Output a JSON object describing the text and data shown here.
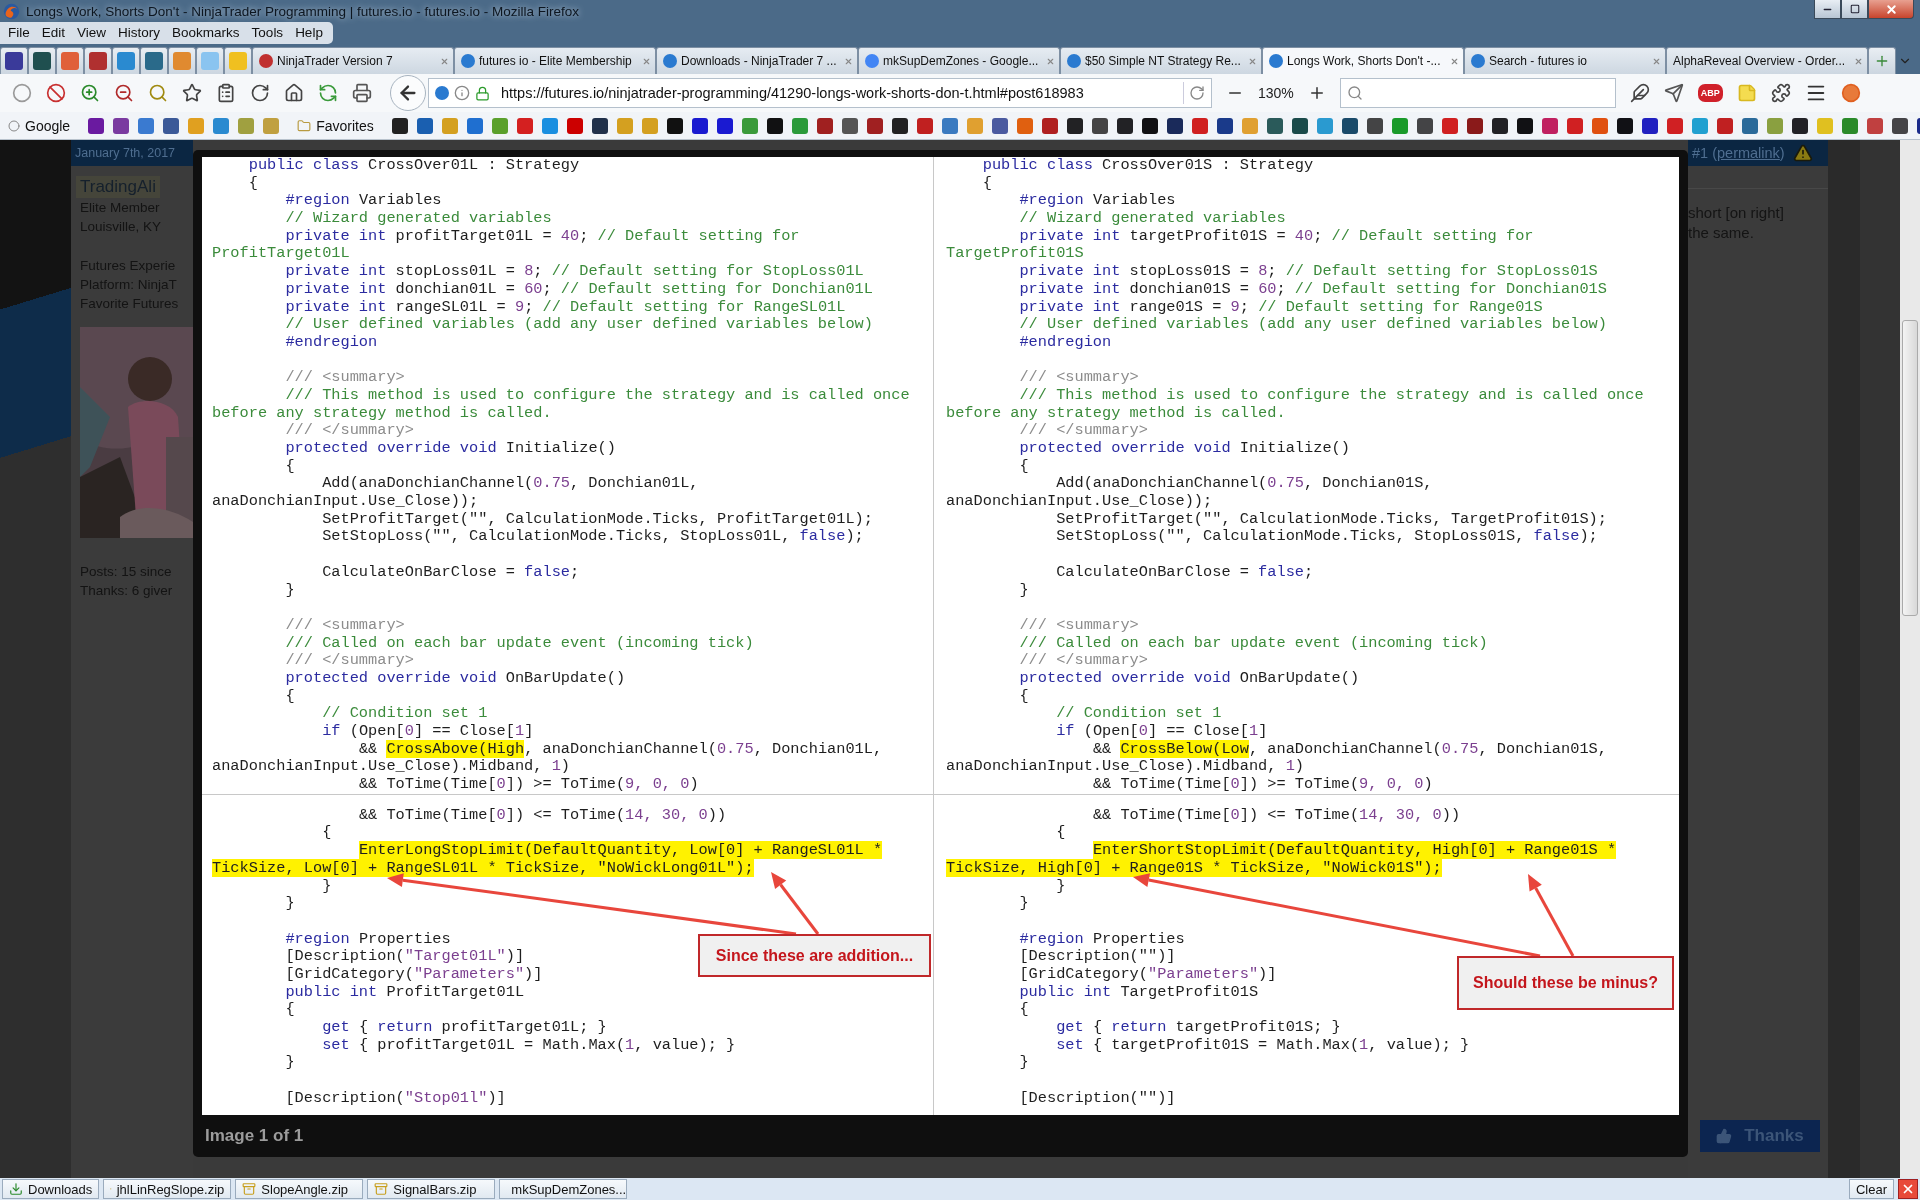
{
  "window": {
    "title": "Longs Work, Shorts Don't - NinjaTrader Programming | futures.io - futures.io - Mozilla Firefox"
  },
  "menu": [
    "File",
    "Edit",
    "View",
    "History",
    "Bookmarks",
    "Tools",
    "Help"
  ],
  "pinned_tabs": [
    {
      "color": "#3a3a9a",
      "selected": false
    },
    {
      "color": "#1f4f4f",
      "selected": false
    },
    {
      "color": "#e0603a",
      "selected": false
    },
    {
      "color": "#b03030",
      "selected": false
    },
    {
      "color": "#2a8ad0",
      "selected": false
    },
    {
      "color": "#2a6a8a",
      "selected": false
    },
    {
      "color": "#e08a30",
      "selected": false
    },
    {
      "color": "#8ac4f0",
      "selected": false
    },
    {
      "color": "#f0c020",
      "selected": false
    }
  ],
  "tabs": [
    {
      "label": "NinjaTrader Version 7",
      "color": "#c03030",
      "selected": false
    },
    {
      "label": "futures io - Elite Membership",
      "color": "#2a7ad0",
      "selected": false
    },
    {
      "label": "Downloads - NinjaTrader 7 ...",
      "color": "#2a7ad0",
      "selected": false
    },
    {
      "label": "mkSupDemZones - Google...",
      "color": "#4285f4",
      "selected": false
    },
    {
      "label": "$50 Simple NT Strategy Re...",
      "color": "#2a7ad0",
      "selected": false
    },
    {
      "label": "Longs Work, Shorts Don't -...",
      "color": "#2a7ad0",
      "selected": true
    },
    {
      "label": "Search - futures io",
      "color": "#2a7ad0",
      "selected": false
    },
    {
      "label": "AlphaReveal Overview - Order...",
      "selected": false
    }
  ],
  "address_bar": {
    "url": "https://futures.io/ninjatrader-programming/41290-longs-work-shorts-don-t.html#post618983"
  },
  "zoom_reading": "130%",
  "adblock_badge": "ABP",
  "bookmarks": {
    "google": "Google",
    "icons_before": [
      {
        "color": "#6a1aa0"
      },
      {
        "color": "#7a3aa0"
      },
      {
        "color": "#3a7ad0"
      },
      {
        "color": "#3b5998"
      },
      {
        "color": "#e0a020"
      },
      {
        "color": "#2a8ad0"
      },
      {
        "color": "#a0a040"
      },
      {
        "color": "#c0a040"
      }
    ],
    "favorites": "Favorites",
    "icons_after": [
      {
        "color": "#222222"
      },
      {
        "color": "#1a5fb0"
      },
      {
        "color": "#d4a020"
      },
      {
        "color": "#1f6fd0"
      },
      {
        "color": "#5aa02c"
      },
      {
        "color": "#d42020"
      },
      {
        "color": "#1a8fe0"
      },
      {
        "color": "#cc0000"
      },
      {
        "color": "#20304a"
      },
      {
        "color": "#d4a020"
      },
      {
        "color": "#d4a021"
      },
      {
        "color": "#111111"
      },
      {
        "color": "#1a1ad0"
      },
      {
        "color": "#1a1ad1"
      },
      {
        "color": "#3a9a3a"
      },
      {
        "color": "#111112"
      },
      {
        "color": "#2a9a3a"
      },
      {
        "color": "#a02020"
      },
      {
        "color": "#555555"
      },
      {
        "color": "#a02021"
      },
      {
        "color": "#222223"
      },
      {
        "color": "#c02020"
      },
      {
        "color": "#3a7ac0"
      },
      {
        "color": "#e0a030"
      },
      {
        "color": "#4a5aa0"
      },
      {
        "color": "#e06010"
      },
      {
        "color": "#b02020"
      },
      {
        "color": "#222224"
      },
      {
        "color": "#444444"
      },
      {
        "color": "#222225"
      },
      {
        "color": "#111113"
      },
      {
        "color": "#1a2a5a"
      },
      {
        "color": "#d02020"
      },
      {
        "color": "#1a3a8a"
      },
      {
        "color": "#e0a031"
      },
      {
        "color": "#2a5a5a"
      },
      {
        "color": "#1a4a4a"
      },
      {
        "color": "#2a9ad0"
      },
      {
        "color": "#1a4a6a"
      },
      {
        "color": "#444445"
      },
      {
        "color": "#1a9a2a"
      },
      {
        "color": "#444446"
      },
      {
        "color": "#d02021"
      },
      {
        "color": "#8a1a1a"
      },
      {
        "color": "#222226"
      },
      {
        "color": "#111114"
      },
      {
        "color": "#c02060"
      },
      {
        "color": "#d02022"
      },
      {
        "color": "#e05010"
      },
      {
        "color": "#111115"
      },
      {
        "color": "#2020c0"
      },
      {
        "color": "#d02023"
      },
      {
        "color": "#20a0d0"
      },
      {
        "color": "#c02021"
      },
      {
        "color": "#2a6a9a"
      },
      {
        "color": "#8aa040"
      },
      {
        "color": "#222227"
      },
      {
        "color": "#e0c020"
      },
      {
        "color": "#2a8a2a"
      },
      {
        "color": "#c04040"
      },
      {
        "color": "#444447"
      },
      {
        "color": "#1a2a8a"
      }
    ]
  },
  "post": {
    "date": "January 7th, 2017",
    "author": "TradingAli",
    "rank": "Elite Member",
    "location": "Louisville, KY",
    "details": [
      "Futures Experie",
      "Platform: NinjaT",
      "Favorite Futures"
    ],
    "photo": {
      "kind": "picture"
    },
    "stats": [
      "Posts: 15 since",
      "Thanks: 6 giver"
    ],
    "post_ref": {
      "before": "#1 (",
      "link": "permalink",
      "after": ")"
    },
    "body": [
      "short [on right]",
      "the same."
    ],
    "thanks_button": "Thanks"
  },
  "lightbox": {
    "caption": "Image 1 of 1",
    "panes": [
      {
        "callout": "Since these are addition...",
        "top": [
          {
            "kind": "code",
            "parts": [
              {
                "kind": "kw",
                "text": "    public class"
              },
              {
                "kind": "pl",
                "text": " CrossOver01L : Strategy"
              }
            ]
          },
          {
            "kind": "code",
            "parts": [
              {
                "kind": "pl",
                "text": "    {"
              }
            ]
          },
          {
            "kind": "code",
            "parts": [
              {
                "kind": "kw",
                "text": "        #region"
              },
              {
                "kind": "pl",
                "text": " Variables"
              }
            ]
          },
          {
            "kind": "code",
            "parts": [
              {
                "kind": "cm",
                "text": "        // Wizard generated variables"
              }
            ]
          },
          {
            "kind": "code",
            "parts": [
              {
                "kind": "kw",
                "text": "        private int"
              },
              {
                "kind": "pl",
                "text": " profitTarget01L = "
              },
              {
                "kind": "num",
                "text": "40"
              },
              {
                "kind": "pl",
                "text": "; "
              },
              {
                "kind": "cm",
                "text": "// Default setting for"
              }
            ]
          },
          {
            "kind": "code",
            "parts": [
              {
                "kind": "cm",
                "text": "ProfitTarget01L"
              }
            ]
          },
          {
            "kind": "code",
            "parts": [
              {
                "kind": "kw",
                "text": "        private int"
              },
              {
                "kind": "pl",
                "text": " stopLoss01L = "
              },
              {
                "kind": "num",
                "text": "8"
              },
              {
                "kind": "pl",
                "text": "; "
              },
              {
                "kind": "cm",
                "text": "// Default setting for StopLoss01L"
              }
            ]
          },
          {
            "kind": "code",
            "parts": [
              {
                "kind": "kw",
                "text": "        private int"
              },
              {
                "kind": "pl",
                "text": " donchian01L = "
              },
              {
                "kind": "num",
                "text": "60"
              },
              {
                "kind": "pl",
                "text": "; "
              },
              {
                "kind": "cm",
                "text": "// Default setting for Donchian01L"
              }
            ]
          },
          {
            "kind": "code",
            "parts": [
              {
                "kind": "kw",
                "text": "        private int"
              },
              {
                "kind": "pl",
                "text": " rangeSL01L = "
              },
              {
                "kind": "num",
                "text": "9"
              },
              {
                "kind": "pl",
                "text": "; "
              },
              {
                "kind": "cm",
                "text": "// Default setting for RangeSL01L"
              }
            ]
          },
          {
            "kind": "code",
            "parts": [
              {
                "kind": "cm",
                "text": "        // User defined variables (add any user defined variables below)"
              }
            ]
          },
          {
            "kind": "code",
            "parts": [
              {
                "kind": "kw",
                "text": "        #endregion"
              }
            ]
          },
          {
            "kind": "blank"
          },
          {
            "kind": "code",
            "parts": [
              {
                "kind": "doc",
                "text": "        /// <summary>"
              }
            ]
          },
          {
            "kind": "code",
            "parts": [
              {
                "kind": "cm",
                "text": "        /// This method is used to configure the strategy and is called once"
              }
            ]
          },
          {
            "kind": "code",
            "parts": [
              {
                "kind": "cm",
                "text": "before any strategy method is called."
              }
            ]
          },
          {
            "kind": "code",
            "parts": [
              {
                "kind": "doc",
                "text": "        /// </summary>"
              }
            ]
          },
          {
            "kind": "code",
            "parts": [
              {
                "kind": "kw",
                "text": "        protected override void"
              },
              {
                "kind": "pl",
                "text": " Initialize()"
              }
            ]
          },
          {
            "kind": "code",
            "parts": [
              {
                "kind": "pl",
                "text": "        {"
              }
            ]
          },
          {
            "kind": "code",
            "parts": [
              {
                "kind": "pl",
                "text": "            Add(anaDonchianChannel("
              },
              {
                "kind": "num",
                "text": "0.75"
              },
              {
                "kind": "pl",
                "text": ", Donchian01L,"
              }
            ]
          },
          {
            "kind": "code",
            "parts": [
              {
                "kind": "pl",
                "text": "anaDonchianInput.Use_Close));"
              }
            ]
          },
          {
            "kind": "code",
            "parts": [
              {
                "kind": "pl",
                "text": "            SetProfitTarget(\"\", CalculationMode.Ticks, ProfitTarget01L);"
              }
            ]
          },
          {
            "kind": "code",
            "parts": [
              {
                "kind": "pl",
                "text": "            SetStopLoss(\"\", CalculationMode.Ticks, StopLoss01L, "
              },
              {
                "kind": "kw",
                "text": "false"
              },
              {
                "kind": "pl",
                "text": ");"
              }
            ]
          },
          {
            "kind": "blank"
          },
          {
            "kind": "code",
            "parts": [
              {
                "kind": "pl",
                "text": "            CalculateOnBarClose = "
              },
              {
                "kind": "kw",
                "text": "false"
              },
              {
                "kind": "pl",
                "text": ";"
              }
            ]
          },
          {
            "kind": "code",
            "parts": [
              {
                "kind": "pl",
                "text": "        }"
              }
            ]
          },
          {
            "kind": "blank"
          },
          {
            "kind": "code",
            "parts": [
              {
                "kind": "doc",
                "text": "        /// <summary>"
              }
            ]
          },
          {
            "kind": "code",
            "parts": [
              {
                "kind": "cm",
                "text": "        /// Called on each bar update event (incoming tick)"
              }
            ]
          },
          {
            "kind": "code",
            "parts": [
              {
                "kind": "doc",
                "text": "        /// </summary>"
              }
            ]
          },
          {
            "kind": "code",
            "parts": [
              {
                "kind": "kw",
                "text": "        protected override void"
              },
              {
                "kind": "pl",
                "text": " OnBarUpdate()"
              }
            ]
          },
          {
            "kind": "code",
            "parts": [
              {
                "kind": "pl",
                "text": "        {"
              }
            ]
          },
          {
            "kind": "code",
            "parts": [
              {
                "kind": "cm",
                "text": "            // Condition set 1"
              }
            ]
          },
          {
            "kind": "code",
            "parts": [
              {
                "kind": "kw",
                "text": "            if"
              },
              {
                "kind": "pl",
                "text": " (Open["
              },
              {
                "kind": "num",
                "text": "0"
              },
              {
                "kind": "pl",
                "text": "] == Close["
              },
              {
                "kind": "num",
                "text": "1"
              },
              {
                "kind": "pl",
                "text": "]"
              }
            ]
          },
          {
            "kind": "code",
            "parts": [
              {
                "kind": "pl",
                "text": "                && "
              },
              {
                "kind": "hl",
                "text": "CrossAbove(High"
              },
              {
                "kind": "pl",
                "text": ", anaDonchianChannel("
              },
              {
                "kind": "num",
                "text": "0.75"
              },
              {
                "kind": "pl",
                "text": ", Donchian01L,"
              }
            ]
          },
          {
            "kind": "code",
            "parts": [
              {
                "kind": "pl",
                "text": "anaDonchianInput.Use_Close).Midband, "
              },
              {
                "kind": "num",
                "text": "1"
              },
              {
                "kind": "pl",
                "text": ")"
              }
            ]
          },
          {
            "kind": "code",
            "parts": [
              {
                "kind": "pl",
                "text": "                && ToTime(Time["
              },
              {
                "kind": "num",
                "text": "0"
              },
              {
                "kind": "pl",
                "text": "]) >= ToTime("
              },
              {
                "kind": "num",
                "text": "9, 0, 0"
              },
              {
                "kind": "pl",
                "text": ")"
              }
            ]
          }
        ],
        "bottom": [
          {
            "kind": "code",
            "parts": [
              {
                "kind": "pl",
                "text": "                && ToTime(Time["
              },
              {
                "kind": "num",
                "text": "0"
              },
              {
                "kind": "pl",
                "text": "]) <= ToTime("
              },
              {
                "kind": "num",
                "text": "14, 30, 0"
              },
              {
                "kind": "pl",
                "text": "))"
              }
            ]
          },
          {
            "kind": "code",
            "parts": [
              {
                "kind": "pl",
                "text": "            {"
              }
            ]
          },
          {
            "kind": "code",
            "parts": [
              {
                "kind": "hl",
                "text": "                EnterLongStopLimit(DefaultQuantity, Low[0] + RangeSL01L *"
              }
            ]
          },
          {
            "kind": "code",
            "parts": [
              {
                "kind": "hl",
                "text": "TickSize, Low[0] + RangeSL01L * TickSize, \"NoWickLong01L\");"
              }
            ]
          },
          {
            "kind": "code",
            "parts": [
              {
                "kind": "pl",
                "text": "            }"
              }
            ]
          },
          {
            "kind": "code",
            "parts": [
              {
                "kind": "pl",
                "text": "        }"
              }
            ]
          },
          {
            "kind": "blank"
          },
          {
            "kind": "code",
            "parts": [
              {
                "kind": "kw",
                "text": "        #region"
              },
              {
                "kind": "pl",
                "text": " Properties"
              }
            ]
          },
          {
            "kind": "code",
            "parts": [
              {
                "kind": "pl",
                "text": "        [Description("
              },
              {
                "kind": "str",
                "text": "\"Target01L\""
              },
              {
                "kind": "pl",
                "text": ")]"
              }
            ]
          },
          {
            "kind": "code",
            "parts": [
              {
                "kind": "pl",
                "text": "        [GridCategory("
              },
              {
                "kind": "str",
                "text": "\"Parameters\""
              },
              {
                "kind": "pl",
                "text": ")]"
              }
            ]
          },
          {
            "kind": "code",
            "parts": [
              {
                "kind": "kw",
                "text": "        public int"
              },
              {
                "kind": "pl",
                "text": " ProfitTarget01L"
              }
            ]
          },
          {
            "kind": "code",
            "parts": [
              {
                "kind": "pl",
                "text": "        {"
              }
            ]
          },
          {
            "kind": "code",
            "parts": [
              {
                "kind": "kw",
                "text": "            get"
              },
              {
                "kind": "pl",
                "text": " { "
              },
              {
                "kind": "kw",
                "text": "return"
              },
              {
                "kind": "pl",
                "text": " profitTarget01L; }"
              }
            ]
          },
          {
            "kind": "code",
            "parts": [
              {
                "kind": "kw",
                "text": "            set"
              },
              {
                "kind": "pl",
                "text": " { profitTarget01L = Math.Max("
              },
              {
                "kind": "num",
                "text": "1"
              },
              {
                "kind": "pl",
                "text": ", value); }"
              }
            ]
          },
          {
            "kind": "code",
            "parts": [
              {
                "kind": "pl",
                "text": "        }"
              }
            ]
          },
          {
            "kind": "blank"
          },
          {
            "kind": "code",
            "parts": [
              {
                "kind": "pl",
                "text": "        [Description("
              },
              {
                "kind": "str",
                "text": "\"Stop01l\""
              },
              {
                "kind": "pl",
                "text": ")]"
              }
            ]
          }
        ]
      },
      {
        "callout": "Should these be minus?",
        "top": [
          {
            "kind": "code",
            "parts": [
              {
                "kind": "kw",
                "text": "    public class"
              },
              {
                "kind": "pl",
                "text": " CrossOver01S : Strategy"
              }
            ]
          },
          {
            "kind": "code",
            "parts": [
              {
                "kind": "pl",
                "text": "    {"
              }
            ]
          },
          {
            "kind": "code",
            "parts": [
              {
                "kind": "kw",
                "text": "        #region"
              },
              {
                "kind": "pl",
                "text": " Variables"
              }
            ]
          },
          {
            "kind": "code",
            "parts": [
              {
                "kind": "cm",
                "text": "        // Wizard generated variables"
              }
            ]
          },
          {
            "kind": "code",
            "parts": [
              {
                "kind": "kw",
                "text": "        private int"
              },
              {
                "kind": "pl",
                "text": " targetProfit01S = "
              },
              {
                "kind": "num",
                "text": "40"
              },
              {
                "kind": "pl",
                "text": "; "
              },
              {
                "kind": "cm",
                "text": "// Default setting for"
              }
            ]
          },
          {
            "kind": "code",
            "parts": [
              {
                "kind": "cm",
                "text": "TargetProfit01S"
              }
            ]
          },
          {
            "kind": "code",
            "parts": [
              {
                "kind": "kw",
                "text": "        private int"
              },
              {
                "kind": "pl",
                "text": " stopLoss01S = "
              },
              {
                "kind": "num",
                "text": "8"
              },
              {
                "kind": "pl",
                "text": "; "
              },
              {
                "kind": "cm",
                "text": "// Default setting for StopLoss01S"
              }
            ]
          },
          {
            "kind": "code",
            "parts": [
              {
                "kind": "kw",
                "text": "        private int"
              },
              {
                "kind": "pl",
                "text": " donchian01S = "
              },
              {
                "kind": "num",
                "text": "60"
              },
              {
                "kind": "pl",
                "text": "; "
              },
              {
                "kind": "cm",
                "text": "// Default setting for Donchian01S"
              }
            ]
          },
          {
            "kind": "code",
            "parts": [
              {
                "kind": "kw",
                "text": "        private int"
              },
              {
                "kind": "pl",
                "text": " range01S = "
              },
              {
                "kind": "num",
                "text": "9"
              },
              {
                "kind": "pl",
                "text": "; "
              },
              {
                "kind": "cm",
                "text": "// Default setting for Range01S"
              }
            ]
          },
          {
            "kind": "code",
            "parts": [
              {
                "kind": "cm",
                "text": "        // User defined variables (add any user defined variables below)"
              }
            ]
          },
          {
            "kind": "code",
            "parts": [
              {
                "kind": "kw",
                "text": "        #endregion"
              }
            ]
          },
          {
            "kind": "blank"
          },
          {
            "kind": "code",
            "parts": [
              {
                "kind": "doc",
                "text": "        /// <summary>"
              }
            ]
          },
          {
            "kind": "code",
            "parts": [
              {
                "kind": "cm",
                "text": "        /// This method is used to configure the strategy and is called once"
              }
            ]
          },
          {
            "kind": "code",
            "parts": [
              {
                "kind": "cm",
                "text": "before any strategy method is called."
              }
            ]
          },
          {
            "kind": "code",
            "parts": [
              {
                "kind": "doc",
                "text": "        /// </summary>"
              }
            ]
          },
          {
            "kind": "code",
            "parts": [
              {
                "kind": "kw",
                "text": "        protected override void"
              },
              {
                "kind": "pl",
                "text": " Initialize()"
              }
            ]
          },
          {
            "kind": "code",
            "parts": [
              {
                "kind": "pl",
                "text": "        {"
              }
            ]
          },
          {
            "kind": "code",
            "parts": [
              {
                "kind": "pl",
                "text": "            Add(anaDonchianChannel("
              },
              {
                "kind": "num",
                "text": "0.75"
              },
              {
                "kind": "pl",
                "text": ", Donchian01S,"
              }
            ]
          },
          {
            "kind": "code",
            "parts": [
              {
                "kind": "pl",
                "text": "anaDonchianInput.Use_Close));"
              }
            ]
          },
          {
            "kind": "code",
            "parts": [
              {
                "kind": "pl",
                "text": "            SetProfitTarget(\"\", CalculationMode.Ticks, TargetProfit01S);"
              }
            ]
          },
          {
            "kind": "code",
            "parts": [
              {
                "kind": "pl",
                "text": "            SetStopLoss(\"\", CalculationMode.Ticks, StopLoss01S, "
              },
              {
                "kind": "kw",
                "text": "false"
              },
              {
                "kind": "pl",
                "text": ");"
              }
            ]
          },
          {
            "kind": "blank"
          },
          {
            "kind": "code",
            "parts": [
              {
                "kind": "pl",
                "text": "            CalculateOnBarClose = "
              },
              {
                "kind": "kw",
                "text": "false"
              },
              {
                "kind": "pl",
                "text": ";"
              }
            ]
          },
          {
            "kind": "code",
            "parts": [
              {
                "kind": "pl",
                "text": "        }"
              }
            ]
          },
          {
            "kind": "blank"
          },
          {
            "kind": "code",
            "parts": [
              {
                "kind": "doc",
                "text": "        /// <summary>"
              }
            ]
          },
          {
            "kind": "code",
            "parts": [
              {
                "kind": "cm",
                "text": "        /// Called on each bar update event (incoming tick)"
              }
            ]
          },
          {
            "kind": "code",
            "parts": [
              {
                "kind": "doc",
                "text": "        /// </summary>"
              }
            ]
          },
          {
            "kind": "code",
            "parts": [
              {
                "kind": "kw",
                "text": "        protected override void"
              },
              {
                "kind": "pl",
                "text": " OnBarUpdate()"
              }
            ]
          },
          {
            "kind": "code",
            "parts": [
              {
                "kind": "pl",
                "text": "        {"
              }
            ]
          },
          {
            "kind": "code",
            "parts": [
              {
                "kind": "cm",
                "text": "            // Condition set 1"
              }
            ]
          },
          {
            "kind": "code",
            "parts": [
              {
                "kind": "kw",
                "text": "            if"
              },
              {
                "kind": "pl",
                "text": " (Open["
              },
              {
                "kind": "num",
                "text": "0"
              },
              {
                "kind": "pl",
                "text": "] == Close["
              },
              {
                "kind": "num",
                "text": "1"
              },
              {
                "kind": "pl",
                "text": "]"
              }
            ]
          },
          {
            "kind": "code",
            "parts": [
              {
                "kind": "pl",
                "text": "                && "
              },
              {
                "kind": "hl",
                "text": "CrossBelow(Low"
              },
              {
                "kind": "pl",
                "text": ", anaDonchianChannel("
              },
              {
                "kind": "num",
                "text": "0.75"
              },
              {
                "kind": "pl",
                "text": ", Donchian01S,"
              }
            ]
          },
          {
            "kind": "code",
            "parts": [
              {
                "kind": "pl",
                "text": "anaDonchianInput.Use_Close).Midband, "
              },
              {
                "kind": "num",
                "text": "1"
              },
              {
                "kind": "pl",
                "text": ")"
              }
            ]
          },
          {
            "kind": "code",
            "parts": [
              {
                "kind": "pl",
                "text": "                && ToTime(Time["
              },
              {
                "kind": "num",
                "text": "0"
              },
              {
                "kind": "pl",
                "text": "]) >= ToTime("
              },
              {
                "kind": "num",
                "text": "9, 0, 0"
              },
              {
                "kind": "pl",
                "text": ")"
              }
            ]
          }
        ],
        "bottom": [
          {
            "kind": "code",
            "parts": [
              {
                "kind": "pl",
                "text": "                && ToTime(Time["
              },
              {
                "kind": "num",
                "text": "0"
              },
              {
                "kind": "pl",
                "text": "]) <= ToTime("
              },
              {
                "kind": "num",
                "text": "14, 30, 0"
              },
              {
                "kind": "pl",
                "text": "))"
              }
            ]
          },
          {
            "kind": "code",
            "parts": [
              {
                "kind": "pl",
                "text": "            {"
              }
            ]
          },
          {
            "kind": "code",
            "parts": [
              {
                "kind": "hl",
                "text": "                EnterShortStopLimit(DefaultQuantity, High[0] + Range01S *"
              }
            ]
          },
          {
            "kind": "code",
            "parts": [
              {
                "kind": "hl",
                "text": "TickSize, High[0] + Range01S * TickSize, \"NoWick01S\");"
              }
            ]
          },
          {
            "kind": "code",
            "parts": [
              {
                "kind": "pl",
                "text": "            }"
              }
            ]
          },
          {
            "kind": "code",
            "parts": [
              {
                "kind": "pl",
                "text": "        }"
              }
            ]
          },
          {
            "kind": "blank"
          },
          {
            "kind": "code",
            "parts": [
              {
                "kind": "kw",
                "text": "        #region"
              },
              {
                "kind": "pl",
                "text": " Properties"
              }
            ]
          },
          {
            "kind": "code",
            "parts": [
              {
                "kind": "pl",
                "text": "        [Description(\"\")]"
              }
            ]
          },
          {
            "kind": "code",
            "parts": [
              {
                "kind": "pl",
                "text": "        [GridCategory("
              },
              {
                "kind": "str",
                "text": "\"Parameters\""
              },
              {
                "kind": "pl",
                "text": ")]"
              }
            ]
          },
          {
            "kind": "code",
            "parts": [
              {
                "kind": "kw",
                "text": "        public int"
              },
              {
                "kind": "pl",
                "text": " TargetProfit01S"
              }
            ]
          },
          {
            "kind": "code",
            "parts": [
              {
                "kind": "pl",
                "text": "        {"
              }
            ]
          },
          {
            "kind": "code",
            "parts": [
              {
                "kind": "kw",
                "text": "            get"
              },
              {
                "kind": "pl",
                "text": " { "
              },
              {
                "kind": "kw",
                "text": "return"
              },
              {
                "kind": "pl",
                "text": " targetProfit01S; }"
              }
            ]
          },
          {
            "kind": "code",
            "parts": [
              {
                "kind": "kw",
                "text": "            set"
              },
              {
                "kind": "pl",
                "text": " { targetProfit01S = Math.Max("
              },
              {
                "kind": "num",
                "text": "1"
              },
              {
                "kind": "pl",
                "text": ", value); }"
              }
            ]
          },
          {
            "kind": "code",
            "parts": [
              {
                "kind": "pl",
                "text": "        }"
              }
            ]
          },
          {
            "kind": "blank"
          },
          {
            "kind": "code",
            "parts": [
              {
                "kind": "pl",
                "text": "        [Description(\"\")]"
              }
            ]
          }
        ]
      }
    ]
  },
  "downloads_bar": {
    "button": "Downloads",
    "files": [
      "jhlLinRegSlope.zip",
      "SlopeAngle.zip",
      "SignalBars.zip",
      "mkSupDemZones..."
    ],
    "clear": "Clear"
  }
}
